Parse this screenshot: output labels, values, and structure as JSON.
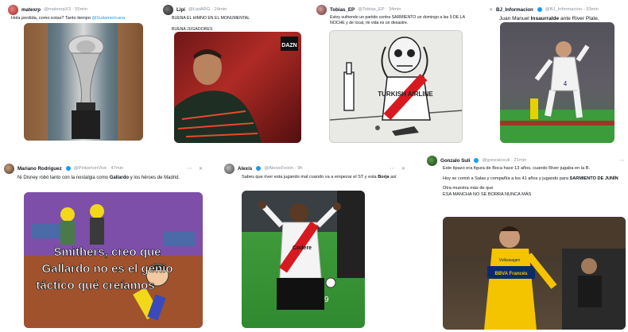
{
  "tweets": [
    {
      "name": "matexrp",
      "handle": "@matexrpX3 · 55min",
      "text": "Hola perdida, como estas? Tanto tiempo",
      "link": "@Sudamericana"
    },
    {
      "name": "Lipi",
      "handle": "@LipiARG · 24min",
      "text": "BUENA EL HIMNO EN EL MONUMENTAL",
      "line2": "BUENA JUGADORES",
      "badge": "DAZN"
    },
    {
      "name": "Tobias_EP",
      "handle": "@Tobias_EP · 34min",
      "text": "Estoy sufriendo un partido contra SARMIENTO un domingo a las 9 DE LA NOCHE y de local, mi vida es un desastre.",
      "shirt": "TURKISH AIRLINE"
    },
    {
      "name": "BJ_Informacion",
      "handle": "@BJ_Informacion · 33min",
      "text_pre": "Juan Manuel ",
      "text_bold": "Insaurralde",
      "text_post": " ante River Plate.",
      "shirt_number": "4"
    },
    {
      "name": "Mariano Rodriguez",
      "handle": "@PinkertonVive · 47min",
      "text_pre": "Ni Disney robó tanto con la nostalgia como ",
      "text_bold": "Gallardo",
      "text_post": " y los héroes de Madrid.",
      "meme_line1": "Smithers, creo que",
      "meme_line2": "Gallardo no es el genio",
      "meme_line3": "táctico qué creíamos"
    },
    {
      "name": "Alexis",
      "handle": "@AlexisFeixin · 9h",
      "text_pre": "Sabes que river esta jugando mal cuando va a empezar el ST y esta ",
      "text_bold": "Borja",
      "text_post": " así",
      "shirt": "Codere",
      "shirt_number": "9"
    },
    {
      "name": "Gonzalo Suli",
      "handle": "@gonzalosuli · 21min",
      "p1": "Este tipazo era figura de Boca hace 13 años, cuando River jugaba en la B.",
      "p2_pre": "Hoy se comió a Salas y compañía a los 41 años y jugando para ",
      "p2_bold": "SARMIENTO DE JUNÍN",
      "p3": "Otra muestra más de que",
      "p4": "ESA MANCHA NO SE BORRA NUNCA MÁS",
      "shirt": "Volkswagen",
      "shirt2": "BBVA Francés"
    }
  ],
  "colors": {
    "link": "#1d9bf0",
    "verified": "#1d9bf0",
    "river_red": "#d71920",
    "boca_blue": "#0b2c6b",
    "boca_gold": "#f5c400"
  },
  "icons": [
    "more-icon",
    "x-logo-icon",
    "verified-icon"
  ]
}
